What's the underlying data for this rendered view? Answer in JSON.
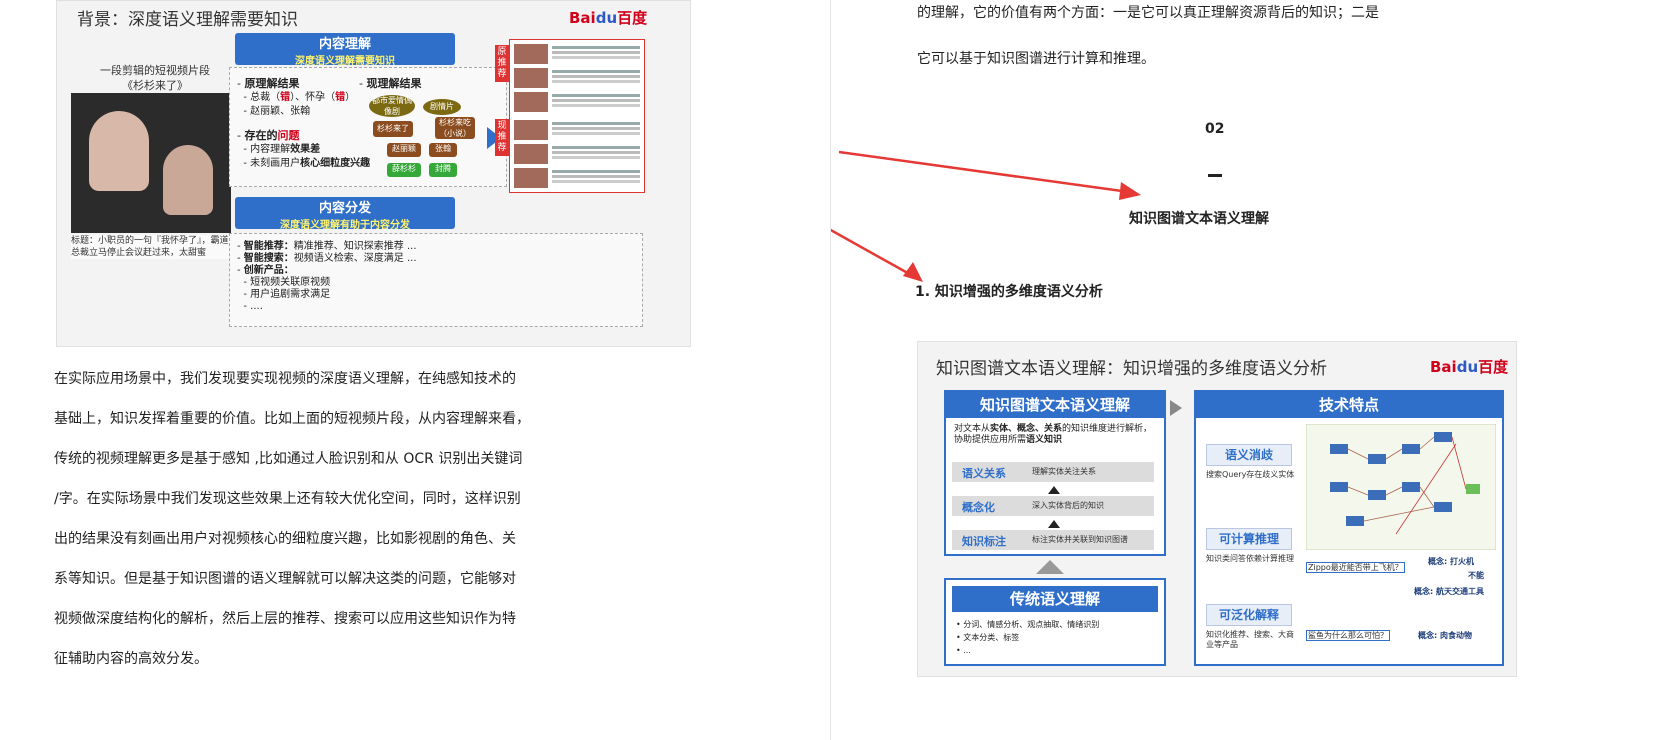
{
  "left": {
    "slide1": {
      "title": "背景：深度语义理解需要知识",
      "logo": {
        "text_a": "Bai",
        "paw": "du",
        "text_b": "百度"
      },
      "video_label": [
        "一段剪辑的短视频片段",
        "《杉杉来了》"
      ],
      "video_caption": "标题：小职员的一句『我怀孕了』，霸道总裁立马停止会议赶过来，太甜蜜",
      "content_understanding": {
        "title": "内容理解",
        "subtitle": "深度语义理解需要知识"
      },
      "principle": {
        "heading": "原理解结果",
        "lines": [
          {
            "pre": "总裁（",
            "red": "错",
            "post": "）、怀孕（",
            "red2": "错",
            "post2": "）"
          },
          {
            "text": "赵丽颖、张翰"
          }
        ]
      },
      "problems": {
        "heading_pre": "存在的",
        "heading_red": "问题",
        "lines": [
          {
            "pre": "内容理解",
            "bold": "效果差"
          },
          {
            "pre": "未刻画用户",
            "bold": "核心细粒度兴趣"
          }
        ]
      },
      "current": {
        "heading": "现理解结果",
        "nodes": [
          "都市爱情偶像剧",
          "剧情片",
          "杉杉来了",
          "杉杉来吃（小说）",
          "赵丽颖",
          "张翰",
          "薛杉杉",
          "封腾"
        ]
      },
      "side_tags": [
        "原推荐",
        "现推荐"
      ],
      "distribution": {
        "title": "内容分发",
        "subtitle": "深度语义理解有助于内容分发"
      },
      "dist_lines": [
        {
          "bold": "智能推荐：",
          "text": "精准推荐、知识探索推荐 ..."
        },
        {
          "bold": "智能搜索：",
          "text": "视频语义检索、深度满足 ..."
        },
        {
          "bold": "创新产品：",
          "text": ""
        },
        {
          "bold": "",
          "text": "短视频关联原视频"
        },
        {
          "bold": "",
          "text": "用户追剧需求满足"
        },
        {
          "bold": "",
          "text": "...."
        }
      ]
    },
    "paragraph": [
      "在实际应用场景中，我们发现要实现视频的深度语义理解，在纯感知技术的",
      "基础上，知识发挥着重要的价值。比如上面的短视频片段，从内容理解来看，",
      "传统的视频理解更多是基于感知 ,比如通过人脸识别和从 OCR 识别出关键词",
      "/字。在实际场景中我们发现这些效果上还有较大优化空间，同时，这样识别",
      "出的结果没有刻画出用户对视频核心的细粒度兴趣，比如影视剧的角色、关",
      "系等知识。但是基于知识图谱的语义理解就可以解决这类的问题，它能够对",
      "视频做深度结构化的解析，然后上层的推荐、搜索可以应用这些知识作为特",
      "征辅助内容的高效分发。"
    ]
  },
  "right": {
    "intro_lines": [
      "的理解，它的价值有两个方面：一是它可以真正理解资源背后的知识；二是",
      "它可以基于知识图谱进行计算和推理。"
    ],
    "section_number": "02",
    "section_title": "知识图谱文本语义理解",
    "subsection": "1. 知识增强的多维度语义分析",
    "arrow_color": "#e53935",
    "slide2": {
      "title": "知识图谱文本语义理解：知识增强的多维度语义分析",
      "logo": {
        "text_a": "Bai",
        "paw": "du",
        "text_b": "百度"
      },
      "panel_left_title": "知识图谱文本语义理解",
      "panel_left_desc_pre": "对文本从",
      "panel_left_desc_b1": "实体、概念、关系",
      "panel_left_desc_mid": "的知识维度进行解析，协助提供应用所需",
      "panel_left_desc_b2": "语义知识",
      "layers": [
        {
          "k": "语义关系",
          "v": "理解实体关注关系"
        },
        {
          "k": "概念化",
          "v": "深入实体背后的知识"
        },
        {
          "k": "知识标注",
          "v": "标注实体并关联到知识图谱"
        }
      ],
      "traditional_title": "传统语义理解",
      "traditional_items": [
        "• 分词、情感分析、观点抽取、情绪识别",
        "• 文本分类、标签",
        "• ..."
      ],
      "panel_right_title": "技术特点",
      "features": [
        {
          "label": "语义消歧",
          "desc": "搜索Query存在歧义实体"
        },
        {
          "label": "可计算推理",
          "desc": "知识类问答依赖计算推理"
        },
        {
          "label": "可泛化解释",
          "desc": "知识化推荐、搜索、大商业等产品"
        }
      ],
      "examples": [
        {
          "text": "Zippo最近能否带上飞机？",
          "c1": "概念: 打火机",
          "c2": "不能",
          "c3": "概念: 航天交通工具"
        },
        {
          "text": "鲨鱼为什么那么可怕？",
          "c1": "概念: 肉食动物"
        }
      ]
    }
  }
}
